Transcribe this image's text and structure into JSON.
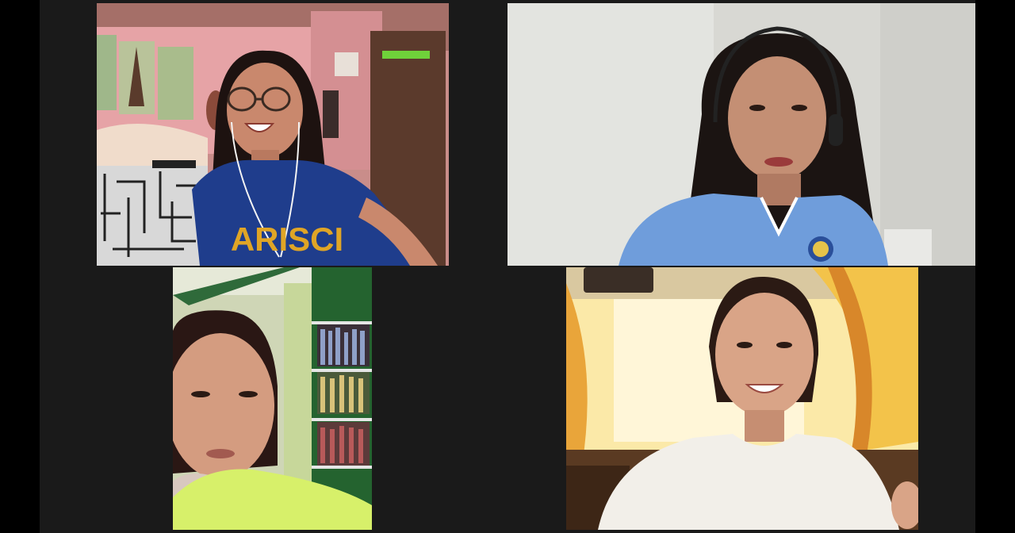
{
  "meeting": {
    "layout": "gallery-view",
    "participant_count": 4
  },
  "participants": [
    {
      "tile": "top-left",
      "shirt_text": "ARISCI",
      "icon": "video-feed"
    },
    {
      "tile": "top-right",
      "icon": "video-feed"
    },
    {
      "tile": "bottom-left",
      "icon": "video-feed"
    },
    {
      "tile": "bottom-right",
      "icon": "video-feed"
    }
  ],
  "colors": {
    "background": "#000000",
    "stage": "#1a1a1a",
    "shirt_navy": "#1f3d8c",
    "shirt_text_gold": "#e0a526",
    "shirt_light_blue": "#6f9ddb",
    "shirt_lime": "#d7f06a",
    "wall_pink": "#e6a3a6",
    "curtain_yellow": "#f3c34a"
  }
}
